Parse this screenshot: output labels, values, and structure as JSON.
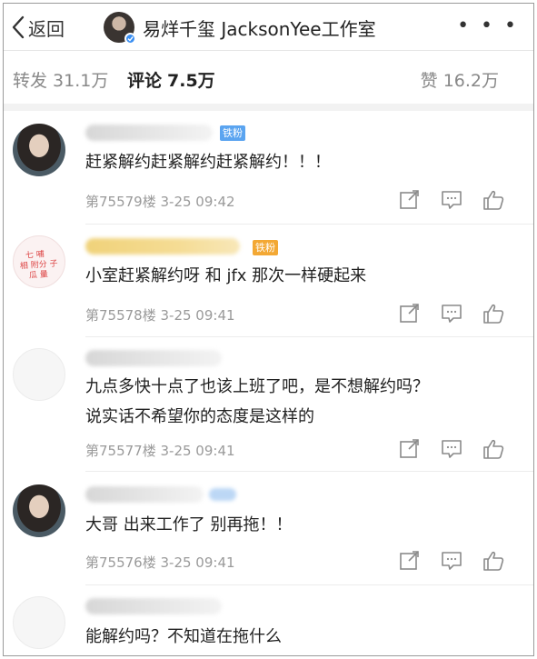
{
  "nav": {
    "back_label": "返回",
    "title": "易烊千玺 JacksonYee工作室",
    "more_label": "• • •"
  },
  "stats": {
    "repost_label": "转发",
    "repost_count": "31.1万",
    "comment_label": "评论",
    "comment_count": "7.5万",
    "like_label": "赞",
    "like_count": "16.2万"
  },
  "comments": [
    {
      "badge": "铁粉",
      "text": "赶紧解约赶紧解约赶紧解约！！！",
      "floor": "第75579楼",
      "time": "3-25 09:42"
    },
    {
      "badge": "铁粉",
      "avatar_text": [
        "七 哺",
        "相 附分 子",
        "瓜 量 "
      ],
      "text": "小室赶紧解约呀 和 jfx 那次一样硬起来",
      "floor": "第75578楼",
      "time": "3-25 09:41"
    },
    {
      "text_line1": "九点多快十点了也该上班了吧，是不想解约吗？",
      "text_line2": "说实话不希望你的态度是这样的",
      "floor": "第75577楼",
      "time": "3-25 09:41"
    },
    {
      "text": "大哥 出来工作了 别再拖！！",
      "floor": "第75576楼",
      "time": "3-25 09:41"
    },
    {
      "text": "能解约吗？不知道在拖什么"
    }
  ],
  "icons": {
    "share": "share-icon",
    "comment": "comment-icon",
    "like": "thumbs-up-icon"
  }
}
